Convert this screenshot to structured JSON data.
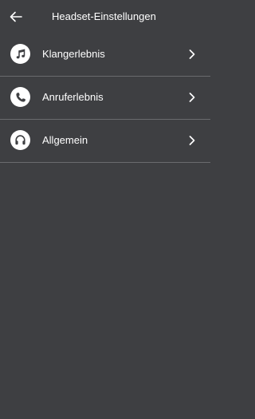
{
  "header": {
    "title": "Headset-Einstellungen",
    "back_icon": "arrow-left-icon"
  },
  "menu": {
    "items": [
      {
        "label": "Klangerlebnis",
        "icon": "music-note-icon"
      },
      {
        "label": "Anruferlebnis",
        "icon": "phone-icon"
      },
      {
        "label": "Allgemein",
        "icon": "headphones-icon"
      }
    ],
    "chevron_icon": "chevron-right-icon"
  },
  "colors": {
    "background": "#3e3f42",
    "text": "#ffffff",
    "divider": "#6a6b6e",
    "icon_bg": "#ffffff",
    "icon_fg": "#3e3f42"
  }
}
